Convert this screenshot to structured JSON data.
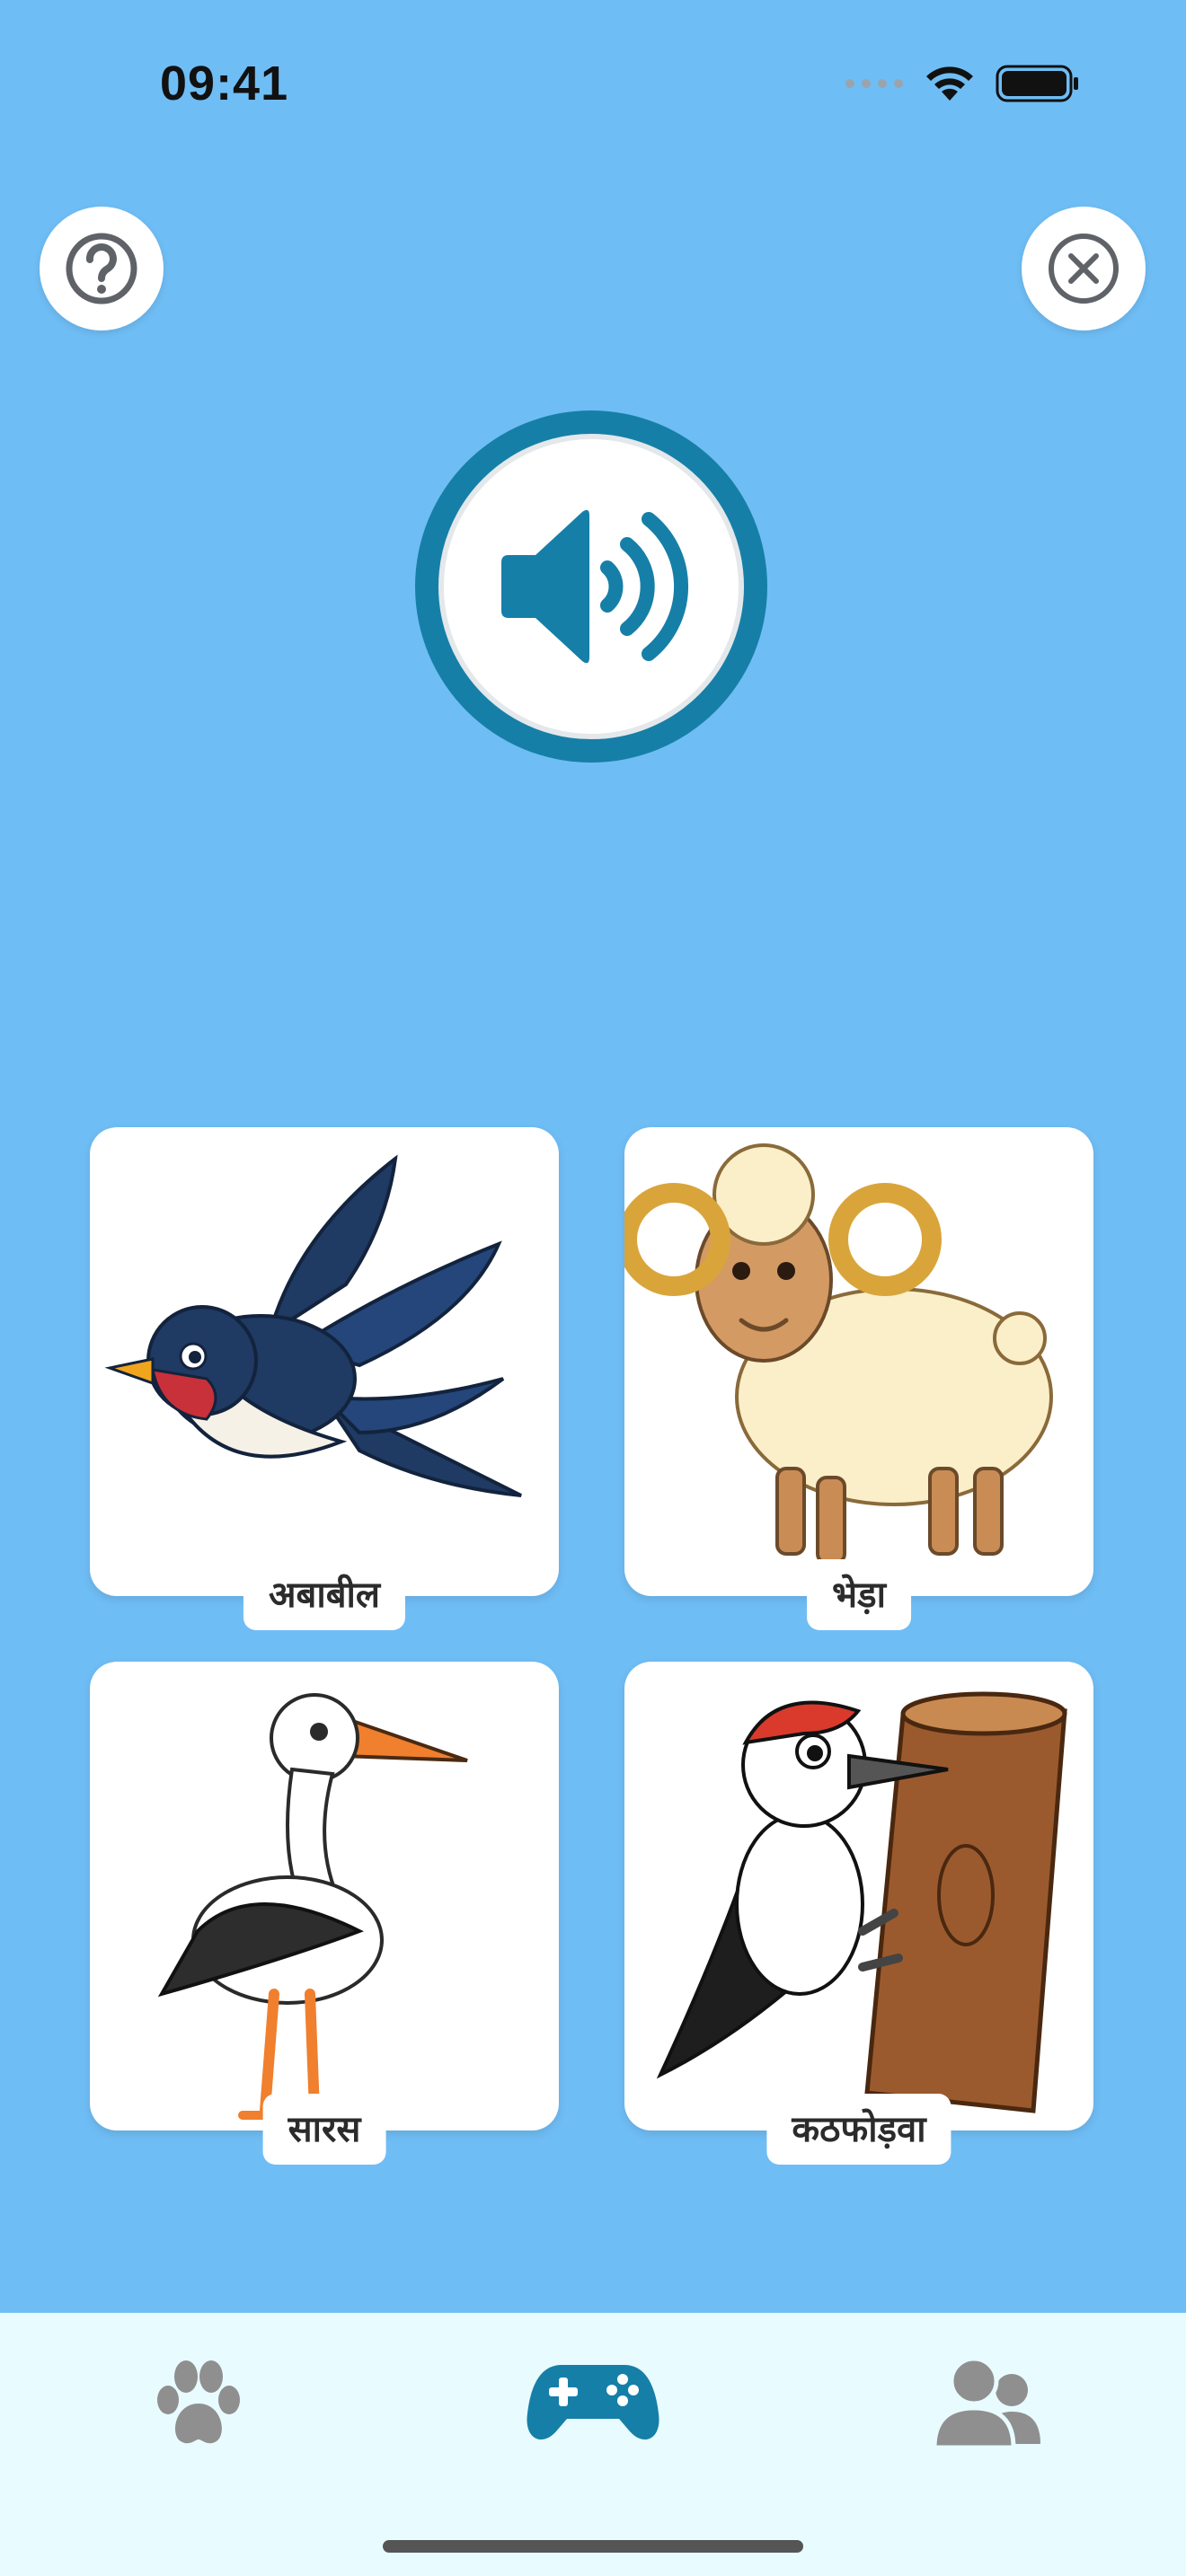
{
  "status_bar": {
    "time": "09:41",
    "icons": [
      "signal-dots-icon",
      "wifi-icon",
      "battery-icon"
    ]
  },
  "top_controls": {
    "help_icon": "question-circle-icon",
    "close_icon": "close-circle-icon"
  },
  "audio_prompt": {
    "icon": "speaker-icon"
  },
  "cards": [
    {
      "label": "अबाबील",
      "image": "swallow-bird-illustration"
    },
    {
      "label": "भेड़ा",
      "image": "ram-sheep-illustration"
    },
    {
      "label": "सारस",
      "image": "stork-illustration"
    },
    {
      "label": "कठफोड़वा",
      "image": "woodpecker-illustration"
    }
  ],
  "tab_bar": {
    "tabs": [
      {
        "icon": "paw-icon",
        "active": false
      },
      {
        "icon": "gamepad-icon",
        "active": true
      },
      {
        "icon": "users-icon",
        "active": false
      }
    ]
  },
  "colors": {
    "background": "#6fbdf5",
    "accent": "#167fa8",
    "tab_bar_background": "#e8fbff",
    "inactive_tab_icon": "#8f8f8f"
  }
}
